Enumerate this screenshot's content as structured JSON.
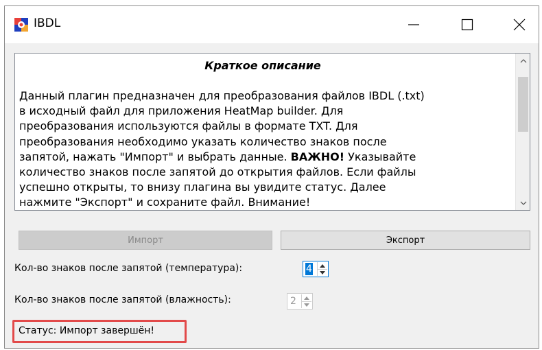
{
  "window": {
    "title": "IBDL"
  },
  "description": {
    "title": "Краткое описание",
    "lines": [
      "Данный плагин предназначен для преобразования файлов IBDL (.txt)",
      "в исходный файл для приложения HeatMap builder. Для",
      "преобразования используются файлы в формате TXT. Для",
      "преобразования необходимо указать количество знаков после",
      "запятой, нажать \"Импорт\" и выбрать данные.",
      "ВАЖНО!",
      "Указывайте",
      "количество знаков после запятой до открытия файлов. Если файлы",
      "успешно открыты, то внизу плагина вы увидите статус. Далее",
      "нажмите \"Экспорт\" и сохраните файл. Внимание!"
    ]
  },
  "buttons": {
    "import_label": "Импорт",
    "export_label": "Экспорт"
  },
  "settings": {
    "temperature_label": "Кол-во знаков после запятой (температура):",
    "temperature_value": "4",
    "humidity_label": "Кол-во знаков после запятой (влажность):",
    "humidity_value": "2"
  },
  "status": {
    "text": "Статус: Импорт завершён!"
  },
  "icons": {
    "app": "app-icon",
    "minimize": "minimize-icon",
    "maximize": "maximize-icon",
    "close": "close-icon",
    "scroll_up": "chevron-up-icon",
    "scroll_down": "chevron-down-icon",
    "spin_up": "spin-up-icon",
    "spin_down": "spin-down-icon"
  },
  "colors": {
    "accent": "#0078d7",
    "highlight_border": "#e24a4a",
    "disabled_button": "#cccccc"
  }
}
